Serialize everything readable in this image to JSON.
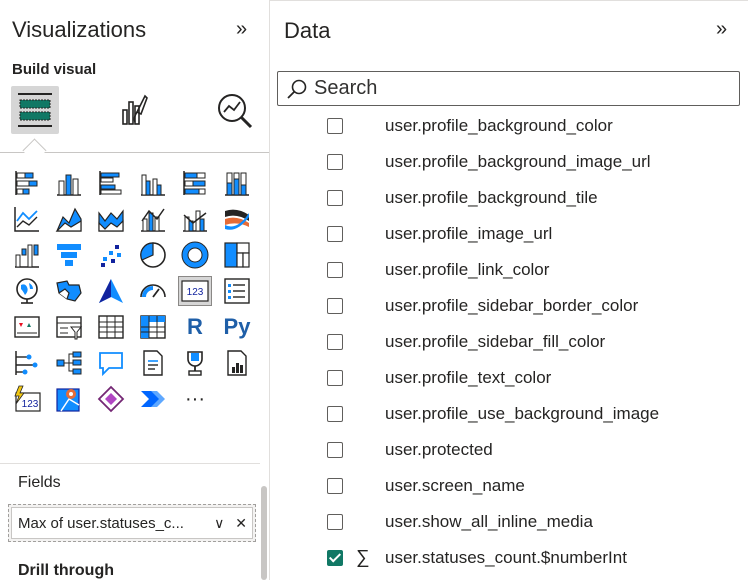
{
  "visualizations": {
    "title": "Visualizations",
    "collapse_glyph": "»",
    "build_visual_label": "Build visual",
    "tabs": [
      {
        "name": "build-visual",
        "icon": "fields-build-icon",
        "selected": true
      },
      {
        "name": "format-visual",
        "icon": "paintbrush-icon",
        "selected": false
      },
      {
        "name": "analytics",
        "icon": "magnifier-chart-icon",
        "selected": false
      }
    ],
    "gallery": [
      "stacked-bar-chart-icon",
      "stacked-column-chart-icon",
      "clustered-bar-chart-icon",
      "clustered-column-chart-icon",
      "100-stacked-bar-chart-icon",
      "100-stacked-column-chart-icon",
      "line-chart-icon",
      "area-chart-icon",
      "stacked-area-chart-icon",
      "line-and-stacked-column-icon",
      "line-and-clustered-column-icon",
      "ribbon-chart-icon",
      "waterfall-chart-icon",
      "funnel-icon",
      "scatter-chart-icon",
      "pie-chart-icon",
      "donut-chart-icon",
      "treemap-icon",
      "map-icon",
      "filled-map-icon",
      "azure-map-icon",
      "gauge-icon",
      "card-icon",
      "multi-row-card-icon",
      "kpi-icon",
      "slicer-icon",
      "table-icon",
      "matrix-icon",
      "r-script-visual-icon",
      "python-visual-icon",
      "key-influencers-icon",
      "decomposition-tree-icon",
      "qa-icon",
      "smart-narrative-icon",
      "metrics-icon",
      "paginated-report-icon",
      "new-card-icon",
      "azure-maps-visual-icon",
      "power-apps-icon",
      "power-automate-icon",
      "more-visuals-icon"
    ],
    "gallery_selected_index": 22,
    "card_text": "123",
    "r_text": "R",
    "py_text": "Py",
    "more_text": "···",
    "fields_label": "Fields",
    "field_value": "Max of user.statuses_c...",
    "chevron_glyph": "∨",
    "close_glyph": "✕",
    "drill_label": "Drill through"
  },
  "data_pane": {
    "title": "Data",
    "collapse_glyph": "»",
    "search_placeholder": "Search",
    "sigma_glyph": "∑",
    "fields": [
      {
        "name": "user.profile_background_color",
        "checked": false
      },
      {
        "name": "user.profile_background_image_url",
        "checked": false
      },
      {
        "name": "user.profile_background_tile",
        "checked": false
      },
      {
        "name": "user.profile_image_url",
        "checked": false
      },
      {
        "name": "user.profile_link_color",
        "checked": false
      },
      {
        "name": "user.profile_sidebar_border_color",
        "checked": false
      },
      {
        "name": "user.profile_sidebar_fill_color",
        "checked": false
      },
      {
        "name": "user.profile_text_color",
        "checked": false
      },
      {
        "name": "user.profile_use_background_image",
        "checked": false
      },
      {
        "name": "user.protected",
        "checked": false
      },
      {
        "name": "user.screen_name",
        "checked": false
      },
      {
        "name": "user.show_all_inline_media",
        "checked": false
      },
      {
        "name": "user.statuses_count.$numberInt",
        "checked": true,
        "sigma": true
      }
    ]
  },
  "colors": {
    "accent_blue": "#118dff",
    "dark_blue": "#12239e",
    "check_green": "#117865",
    "border": "#c8c6c4"
  }
}
